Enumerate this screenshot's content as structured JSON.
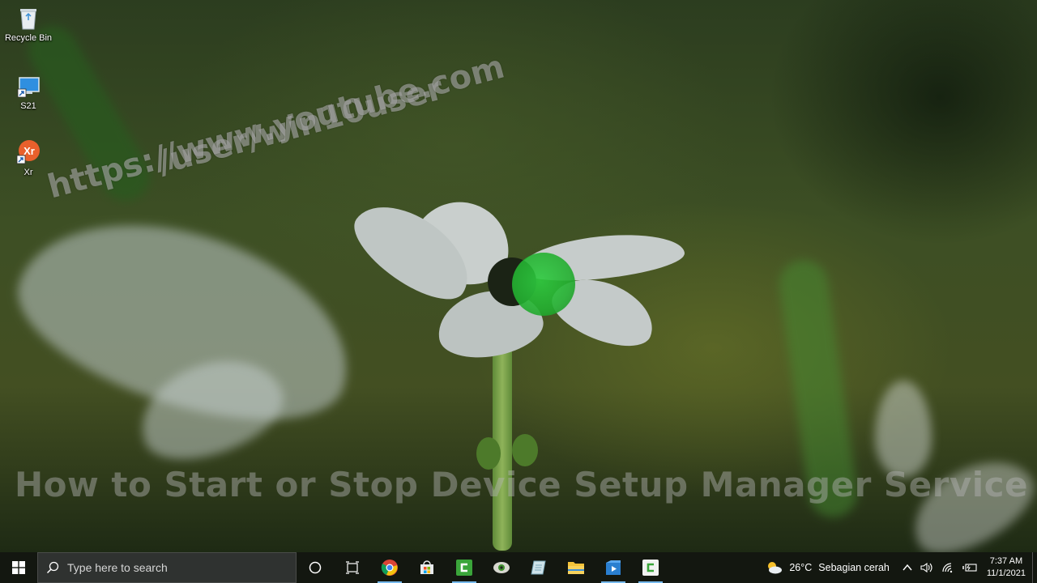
{
  "desktop": {
    "icons": [
      {
        "label": "Recycle Bin",
        "icon": "recycle-bin-icon"
      },
      {
        "label": "S21",
        "icon": "computer-shortcut-icon"
      },
      {
        "label": "Xr",
        "icon": "xr-app-icon"
      }
    ],
    "watermark_line1": "https://www.youtube.com",
    "watermark_line2": "/user/win10user",
    "video_title": "How to Start or Stop Device Setup Manager Service"
  },
  "taskbar": {
    "search_placeholder": "Type here to search",
    "apps": [
      {
        "name": "chrome-icon",
        "running": true
      },
      {
        "name": "microsoft-store-icon",
        "running": false
      },
      {
        "name": "camtasia-icon",
        "running": true
      },
      {
        "name": "audio-app-icon",
        "running": false
      },
      {
        "name": "notepad-icon",
        "running": false
      },
      {
        "name": "file-explorer-icon",
        "running": false
      },
      {
        "name": "media-app-icon",
        "running": true
      },
      {
        "name": "camtasia-recorder-icon",
        "running": true
      }
    ],
    "weather": {
      "temp": "26°C",
      "condition": "Sebagian cerah"
    },
    "clock": {
      "time": "7:37 AM",
      "date": "11/1/2021"
    }
  },
  "colors": {
    "cursor_highlight": "#2ecc40",
    "taskbar_bg": "#121610",
    "running_indicator": "#76b9ed"
  }
}
